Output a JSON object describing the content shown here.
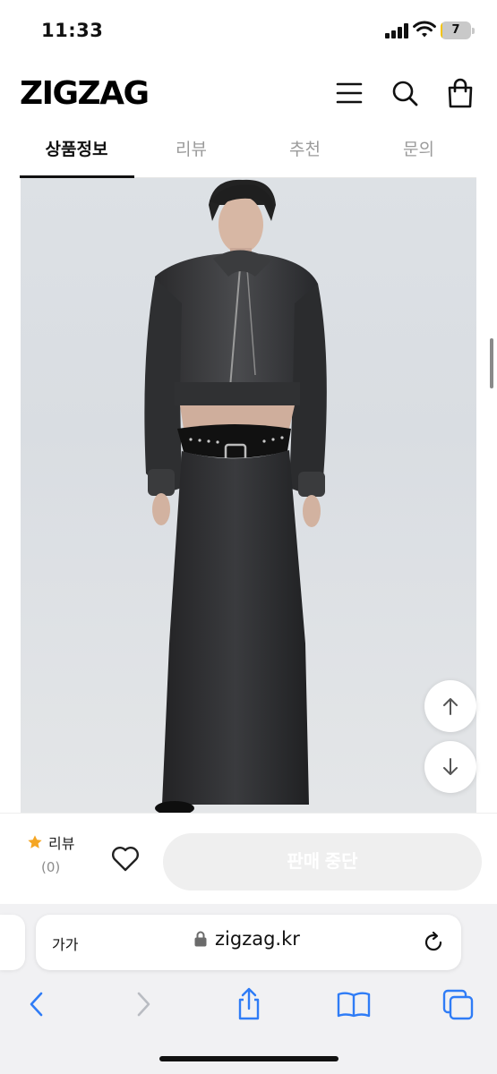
{
  "status_bar": {
    "time": "11:33",
    "battery_level": "7",
    "battery_fraction": 0.07,
    "icons": [
      "signal-icon",
      "wifi-icon",
      "battery-icon"
    ]
  },
  "header": {
    "logo": "ZIGZAG",
    "icons": [
      "menu-icon",
      "search-icon",
      "shopping-bag-icon"
    ]
  },
  "tabs": [
    {
      "label": "상품정보",
      "active": true
    },
    {
      "label": "리뷰",
      "active": false
    },
    {
      "label": "추천",
      "active": false
    },
    {
      "label": "문의",
      "active": false
    }
  ],
  "product": {
    "image_icon": "product-photo",
    "scroll_buttons": [
      "arrow-up-icon",
      "arrow-down-icon"
    ]
  },
  "purchase_bar": {
    "review_label": "리뷰",
    "review_count": "(0)",
    "star_color": "#f5a623",
    "heart_icon": "heart-outline-icon",
    "cta_label": "판매 중단",
    "cta_color": "#efefef"
  },
  "safari": {
    "text_size_label": "가가",
    "url": "zigzag.kr",
    "toolbar_icons": [
      "back-icon",
      "forward-icon",
      "share-icon",
      "bookmarks-icon",
      "tabs-icon"
    ],
    "accent_color": "#2f7cf6"
  }
}
